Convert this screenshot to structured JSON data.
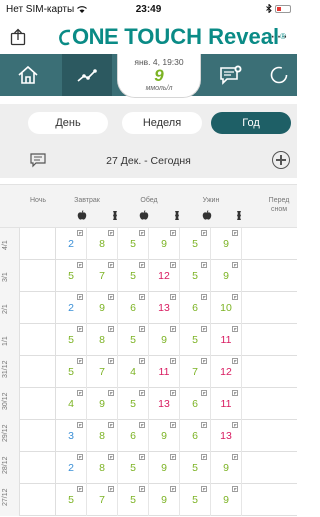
{
  "status_bar": {
    "carrier": "Нет SIM-карты",
    "time": "23:49"
  },
  "header": {
    "logo_prefix": "ONE",
    "logo_main": "TOUCH Reveal",
    "logo_mark": "®",
    "more_label": "···"
  },
  "reading": {
    "date": "янв. 4, 19:30",
    "value": "9",
    "unit": "ммоль/л"
  },
  "tabs": [
    {
      "label": "День"
    },
    {
      "label": "Неделя"
    },
    {
      "label": "Год"
    }
  ],
  "date_range": "27 Дек. - Сегодня",
  "columns": {
    "night": "Ночь",
    "breakfast": "Завтрак",
    "lunch": "Обед",
    "dinner": "Ужин",
    "bedtime": "Перед сном"
  },
  "rows": [
    {
      "date": "4/1",
      "values": [
        "2",
        "8",
        "5",
        "9",
        "5",
        "9"
      ],
      "colors": [
        "#3a8fd6",
        "#7cb324",
        "#7cb324",
        "#7cb324",
        "#7cb324",
        "#7cb324"
      ]
    },
    {
      "date": "3/1",
      "values": [
        "5",
        "7",
        "5",
        "12",
        "5",
        "9"
      ],
      "colors": [
        "#7cb324",
        "#7cb324",
        "#7cb324",
        "#d81b60",
        "#7cb324",
        "#7cb324"
      ]
    },
    {
      "date": "2/1",
      "values": [
        "2",
        "9",
        "6",
        "13",
        "6",
        "10"
      ],
      "colors": [
        "#3a8fd6",
        "#7cb324",
        "#7cb324",
        "#d81b60",
        "#7cb324",
        "#7cb324"
      ]
    },
    {
      "date": "1/1",
      "values": [
        "5",
        "8",
        "5",
        "9",
        "5",
        "11"
      ],
      "colors": [
        "#7cb324",
        "#7cb324",
        "#7cb324",
        "#7cb324",
        "#7cb324",
        "#d81b60"
      ]
    },
    {
      "date": "31/12",
      "values": [
        "5",
        "7",
        "4",
        "11",
        "7",
        "12"
      ],
      "colors": [
        "#7cb324",
        "#7cb324",
        "#7cb324",
        "#d81b60",
        "#7cb324",
        "#d81b60"
      ]
    },
    {
      "date": "30/12",
      "values": [
        "4",
        "9",
        "5",
        "13",
        "6",
        "11"
      ],
      "colors": [
        "#7cb324",
        "#7cb324",
        "#7cb324",
        "#d81b60",
        "#7cb324",
        "#d81b60"
      ]
    },
    {
      "date": "29/12",
      "values": [
        "3",
        "8",
        "6",
        "9",
        "6",
        "13"
      ],
      "colors": [
        "#3a8fd6",
        "#7cb324",
        "#7cb324",
        "#7cb324",
        "#7cb324",
        "#d81b60"
      ]
    },
    {
      "date": "28/12",
      "values": [
        "2",
        "8",
        "5",
        "9",
        "5",
        "9"
      ],
      "colors": [
        "#3a8fd6",
        "#7cb324",
        "#7cb324",
        "#7cb324",
        "#7cb324",
        "#7cb324"
      ]
    },
    {
      "date": "27/12",
      "values": [
        "5",
        "7",
        "5",
        "9",
        "5",
        "9"
      ],
      "colors": [
        "#7cb324",
        "#7cb324",
        "#7cb324",
        "#7cb324",
        "#7cb324",
        "#7cb324"
      ]
    }
  ],
  "icons": {
    "share": "share-icon",
    "home": "home-icon",
    "trend": "trend-icon",
    "messages": "message-icon",
    "sync": "sync-icon",
    "note": "note-icon",
    "add": "add-icon",
    "before_meal": "apple-icon",
    "after_meal": "apple-core-icon"
  },
  "colors": {
    "brand": "#0a8b86",
    "nav": "#3b6f76",
    "in_range": "#7cb324",
    "high": "#d81b60",
    "low": "#3a8fd6",
    "active_tab": "#1e5f66"
  }
}
